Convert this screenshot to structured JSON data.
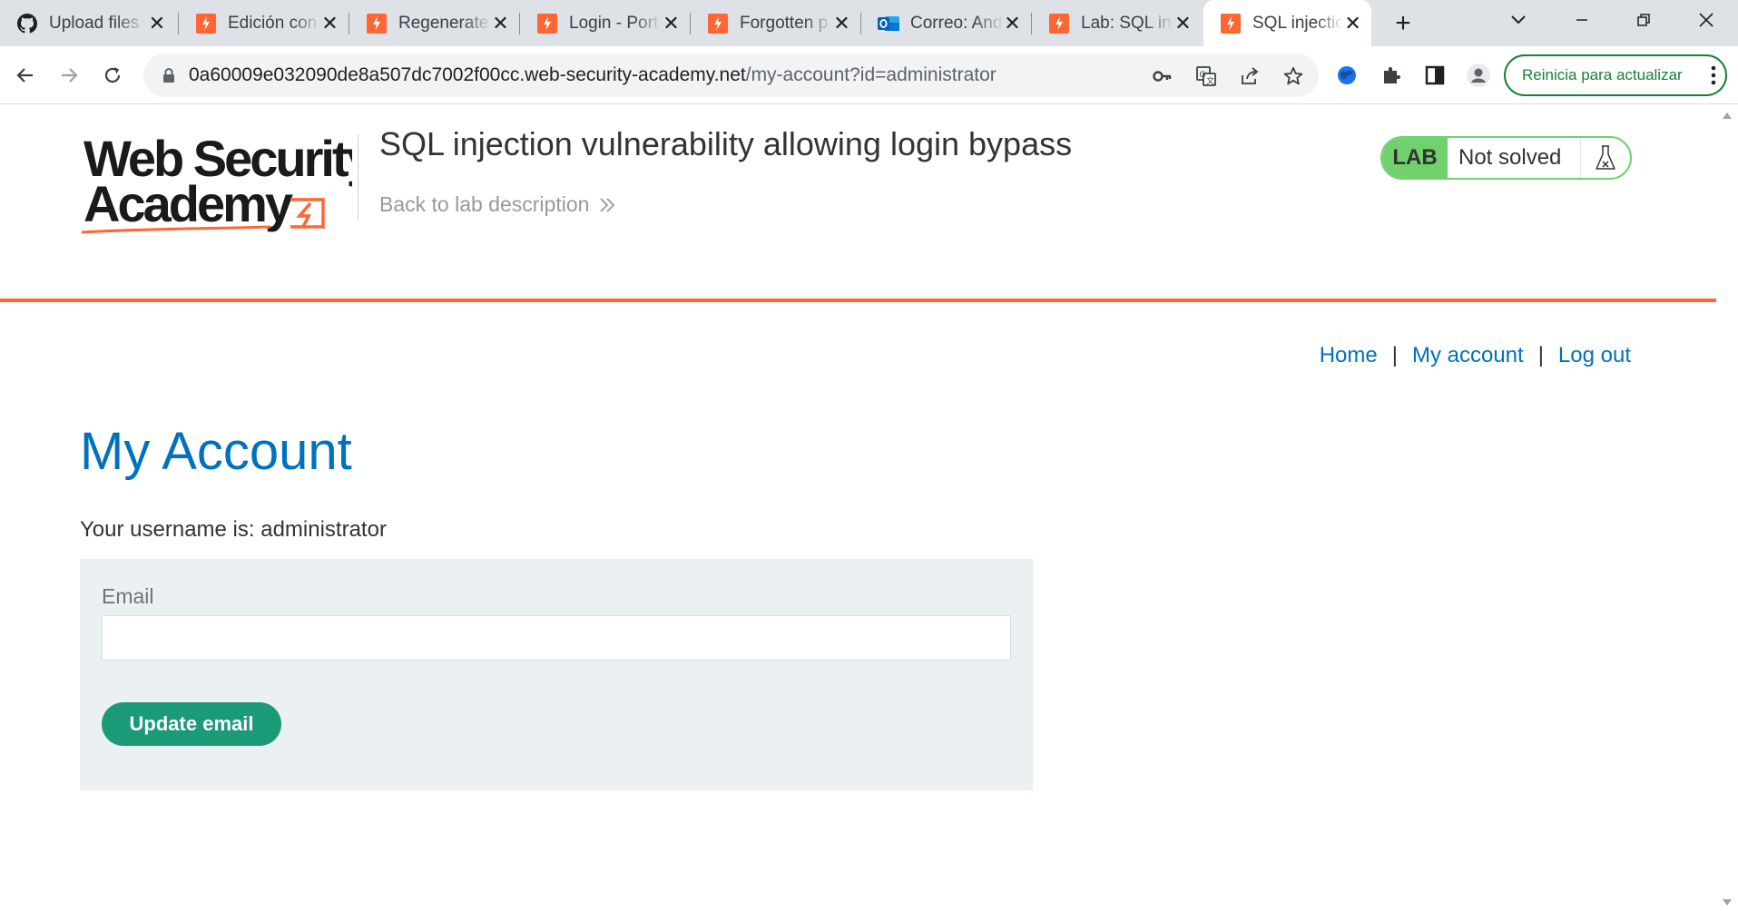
{
  "browser": {
    "tabs": [
      {
        "title": "Upload files",
        "favicon": "github-icon",
        "active": false
      },
      {
        "title": "Edición con",
        "favicon": "portswigger-icon",
        "active": false
      },
      {
        "title": "Regenerate",
        "favicon": "portswigger-icon",
        "active": false
      },
      {
        "title": "Login - Port",
        "favicon": "portswigger-icon",
        "active": false
      },
      {
        "title": "Forgotten p",
        "favicon": "portswigger-icon",
        "active": false
      },
      {
        "title": "Correo: And",
        "favicon": "outlook-icon",
        "active": false
      },
      {
        "title": "Lab: SQL inj",
        "favicon": "portswigger-icon",
        "active": false
      },
      {
        "title": "SQL injectio",
        "favicon": "portswigger-icon",
        "active": true
      }
    ],
    "url_host": "0a60009e032090de8a507dc7002f00cc.web-security-academy.net",
    "url_path": "/my-account?id=administrator",
    "update_button_label": "Reinicia para actualizar"
  },
  "header": {
    "logo_line1": "Web Security",
    "logo_line2": "Academy",
    "lab_title": "SQL injection vulnerability allowing login bypass",
    "back_link": "Back to lab description",
    "lab_tag": "LAB",
    "lab_status": "Not solved"
  },
  "colors": {
    "accent_orange": "#ff6633",
    "link_blue": "#0071bc",
    "lab_green": "#70d16d",
    "button_green": "#1a9a78"
  },
  "nav": {
    "home": "Home",
    "my_account": "My account",
    "log_out": "Log out",
    "separator": "|"
  },
  "main": {
    "title": "My Account",
    "username_line": "Your username is: administrator",
    "email_label": "Email",
    "email_value": "",
    "update_button": "Update email"
  }
}
